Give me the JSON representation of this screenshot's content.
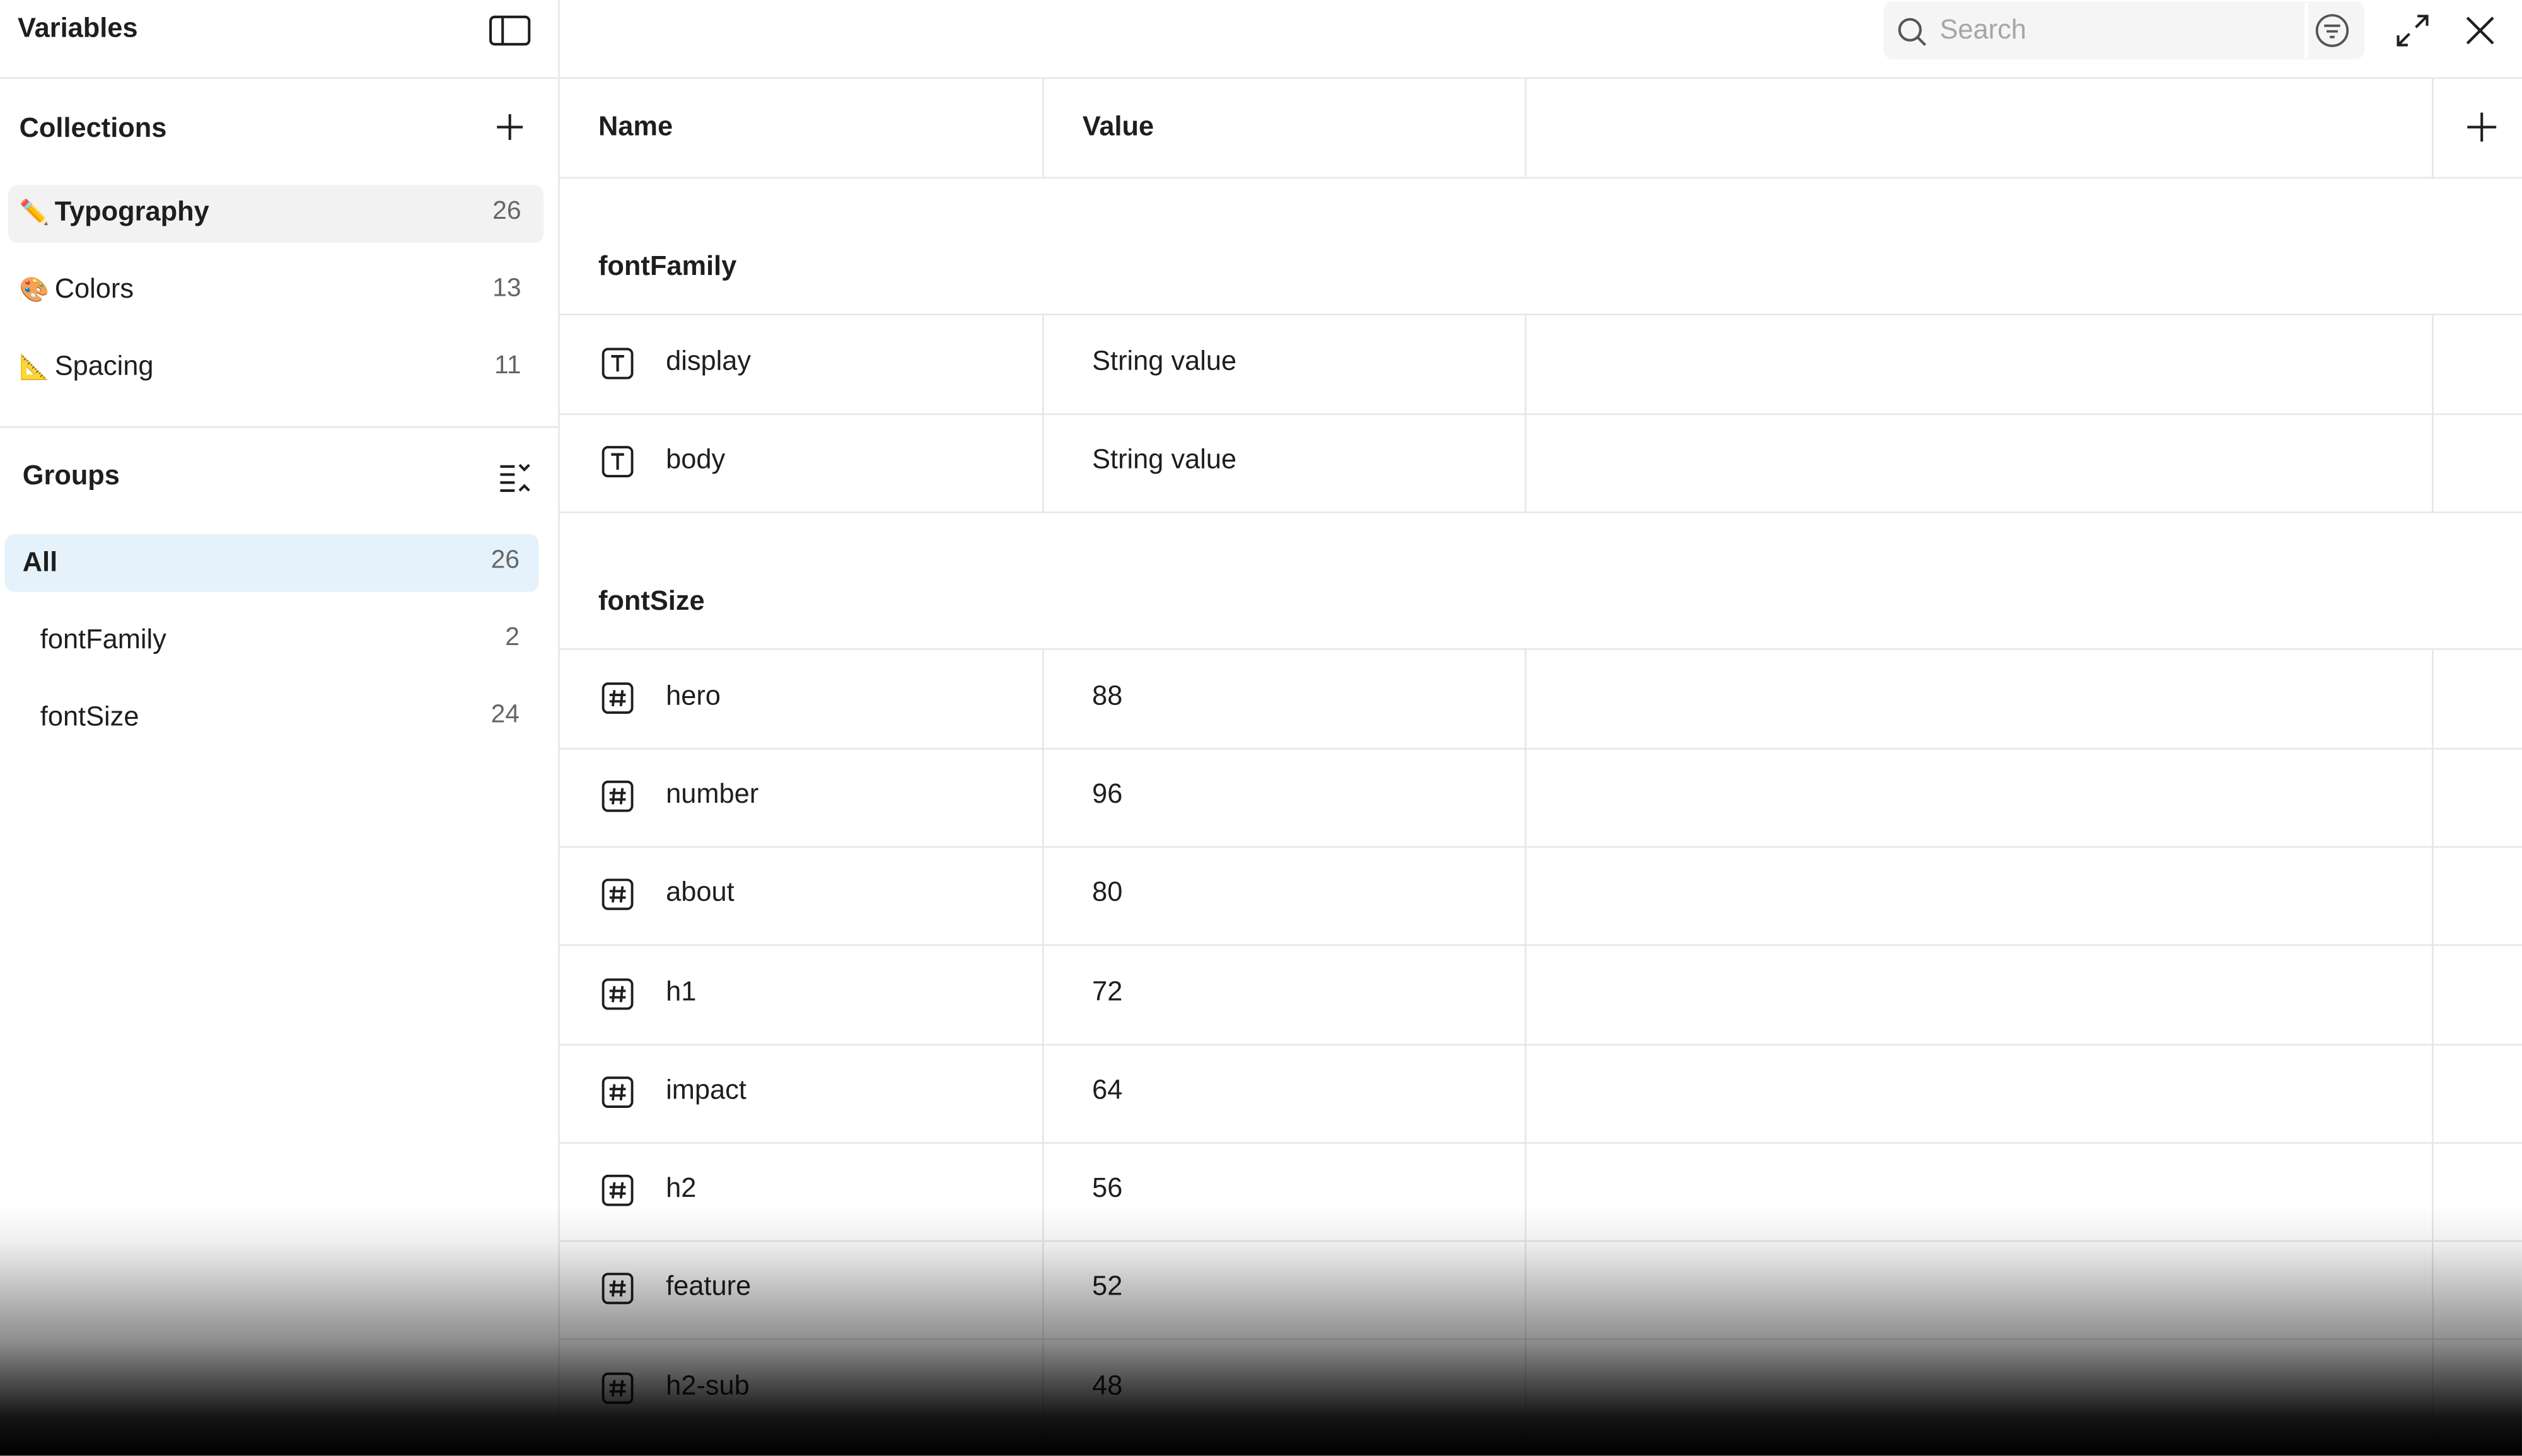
{
  "sidebar": {
    "title": "Variables",
    "collections": {
      "label": "Collections",
      "items": [
        {
          "emoji": "✏️",
          "name": "Typography",
          "count": "26"
        },
        {
          "emoji": "🎨",
          "name": "Colors",
          "count": "13"
        },
        {
          "emoji": "📐",
          "name": "Spacing",
          "count": "11"
        }
      ]
    },
    "groups": {
      "label": "Groups",
      "items": [
        {
          "name": "All",
          "count": "26"
        },
        {
          "name": "fontFamily",
          "count": "2"
        },
        {
          "name": "fontSize",
          "count": "24"
        }
      ]
    }
  },
  "search": {
    "placeholder": "Search"
  },
  "table": {
    "headers": {
      "name": "Name",
      "value": "Value"
    },
    "groups": [
      {
        "title": "fontFamily",
        "rows": [
          {
            "type": "text-type-icon",
            "name": "display",
            "value": "String value"
          },
          {
            "type": "text-type-icon",
            "name": "body",
            "value": "String value"
          }
        ]
      },
      {
        "title": "fontSize",
        "rows": [
          {
            "type": "number-type-icon",
            "name": "hero",
            "value": "88"
          },
          {
            "type": "number-type-icon",
            "name": "number",
            "value": "96"
          },
          {
            "type": "number-type-icon",
            "name": "about",
            "value": "80"
          },
          {
            "type": "number-type-icon",
            "name": "h1",
            "value": "72"
          },
          {
            "type": "number-type-icon",
            "name": "impact",
            "value": "64"
          },
          {
            "type": "number-type-icon",
            "name": "h2",
            "value": "56"
          },
          {
            "type": "number-type-icon",
            "name": "feature",
            "value": "52"
          },
          {
            "type": "number-type-icon",
            "name": "h2-sub",
            "value": "48"
          }
        ]
      }
    ]
  },
  "colors": {
    "active_collection_bg": "#f2f2f2",
    "active_group_bg": "#e5f2fc",
    "border": "#e6e6e6",
    "search_bg": "#f5f5f5"
  }
}
